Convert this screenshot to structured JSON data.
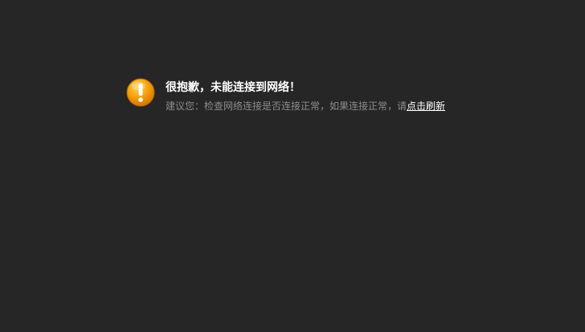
{
  "error": {
    "icon": "warning-exclamation-icon",
    "icon_color": "#f6a00c",
    "title": "很抱歉，未能连接到网络！",
    "suggestion_text": "建议您：检查网络连接是否连接正常，如果连接正常，请",
    "refresh_link_label": "点击刷新"
  },
  "colors": {
    "background": "#262626",
    "title": "#ffffff",
    "suggestion": "#8c8c8c",
    "link": "#ffffff"
  }
}
